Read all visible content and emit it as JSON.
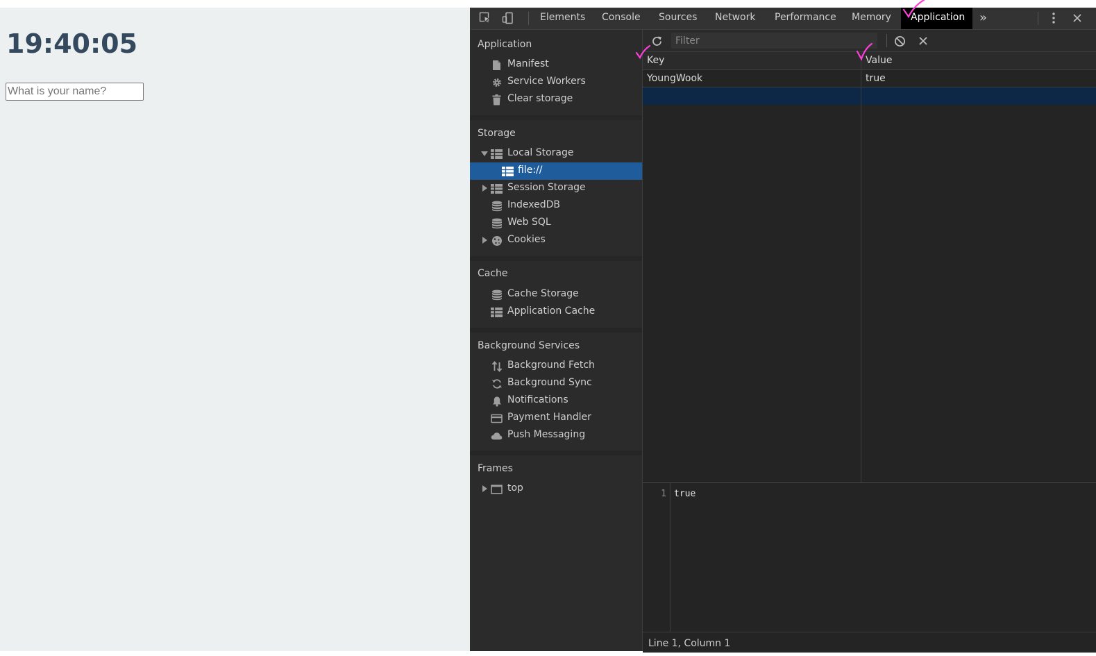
{
  "page": {
    "clock": "19:40:05",
    "name_placeholder": "What is your name?"
  },
  "devtools": {
    "tabs": [
      {
        "label": "Elements",
        "active": false
      },
      {
        "label": "Console",
        "active": false
      },
      {
        "label": "Sources",
        "active": false
      },
      {
        "label": "Network",
        "active": false
      },
      {
        "label": "Performance",
        "active": false
      },
      {
        "label": "Memory",
        "active": false
      },
      {
        "label": "Application",
        "active": true
      }
    ],
    "more_tabs_glyph": "»",
    "sidebar": {
      "sections": [
        {
          "title": "Application",
          "items": [
            {
              "label": "Manifest",
              "icon": "document-icon"
            },
            {
              "label": "Service Workers",
              "icon": "gear-icon"
            },
            {
              "label": "Clear storage",
              "icon": "trash-icon"
            }
          ]
        },
        {
          "title": "Storage",
          "items": [
            {
              "label": "Local Storage",
              "icon": "grid-icon",
              "expanded": true
            },
            {
              "label": "file://",
              "icon": "grid-icon",
              "selected": true
            },
            {
              "label": "Session Storage",
              "icon": "grid-icon",
              "expanded": false
            },
            {
              "label": "IndexedDB",
              "icon": "database-icon"
            },
            {
              "label": "Web SQL",
              "icon": "database-icon"
            },
            {
              "label": "Cookies",
              "icon": "cookie-icon",
              "expanded": false
            }
          ]
        },
        {
          "title": "Cache",
          "items": [
            {
              "label": "Cache Storage",
              "icon": "database-icon"
            },
            {
              "label": "Application Cache",
              "icon": "grid-icon"
            }
          ]
        },
        {
          "title": "Background Services",
          "items": [
            {
              "label": "Background Fetch",
              "icon": "up-down-arrows-icon"
            },
            {
              "label": "Background Sync",
              "icon": "sync-icon"
            },
            {
              "label": "Notifications",
              "icon": "bell-icon"
            },
            {
              "label": "Payment Handler",
              "icon": "card-icon"
            },
            {
              "label": "Push Messaging",
              "icon": "cloud-icon"
            }
          ]
        },
        {
          "title": "Frames",
          "items": [
            {
              "label": "top",
              "icon": "frame-icon",
              "expanded": false
            }
          ]
        }
      ]
    },
    "storage": {
      "filter_placeholder": "Filter",
      "columns": {
        "key": "Key",
        "value": "Value"
      },
      "rows": [
        {
          "key": "YoungWook",
          "value": "true"
        }
      ],
      "preview": {
        "line_number": "1",
        "content": "true"
      },
      "status": "Line 1, Column 1"
    },
    "colors": {
      "selected_item": "#1f5c9c",
      "active_tab": "#000000",
      "annotation_check": "#ff3fd8"
    }
  }
}
